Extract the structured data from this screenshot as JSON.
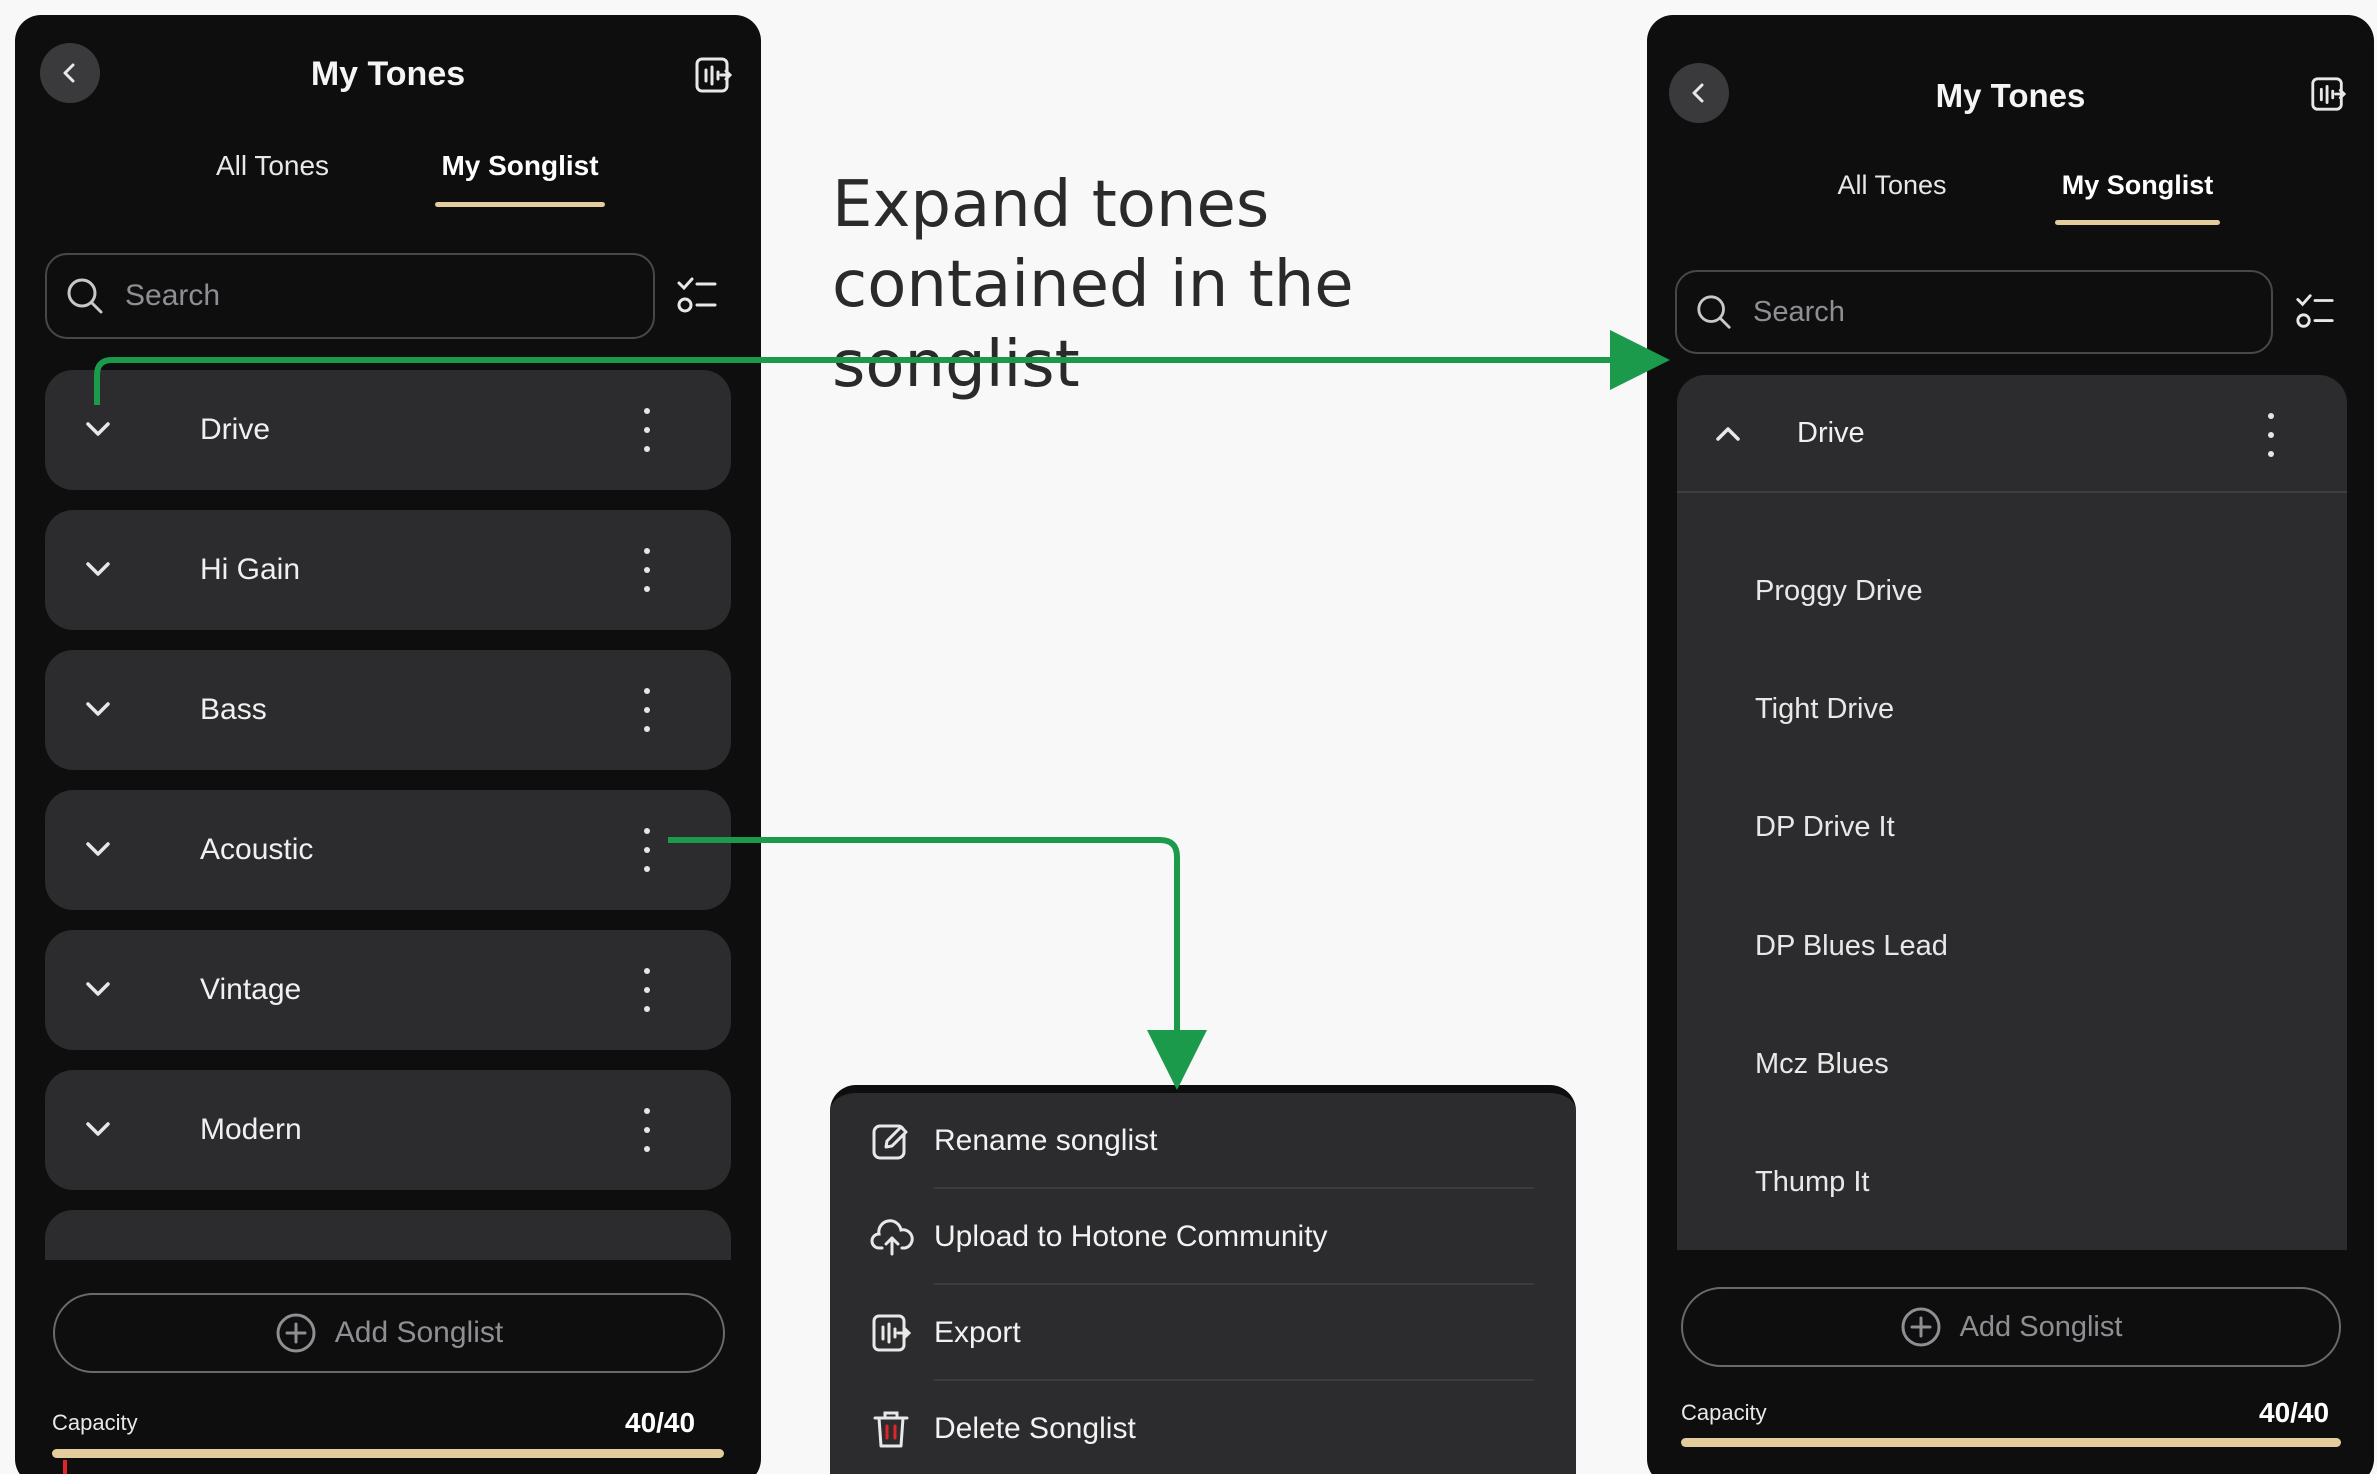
{
  "caption": "Expand tones contained in the songlist",
  "left_screen": {
    "title": "My Tones",
    "tabs": [
      "All Tones",
      "My Songlist"
    ],
    "active_tab": "My Songlist",
    "search": {
      "placeholder": "Search"
    },
    "songlists": [
      "Drive",
      "Hi Gain",
      "Bass",
      "Acoustic",
      "Vintage",
      "Modern"
    ],
    "add_songlist_label": "Add Songlist",
    "capacity": {
      "label": "Capacity",
      "value": "40/40",
      "fraction": 1.0
    }
  },
  "context_menu": {
    "items": [
      {
        "label": "Rename songlist",
        "icon": "edit-icon"
      },
      {
        "label": "Upload to Hotone Community",
        "icon": "cloud-upload-icon"
      },
      {
        "label": "Export",
        "icon": "export-icon"
      },
      {
        "label": "Delete Songlist",
        "icon": "trash-icon"
      }
    ]
  },
  "right_screen": {
    "title": "My Tones",
    "tabs": [
      "All Tones",
      "My Songlist"
    ],
    "active_tab": "My Songlist",
    "search": {
      "placeholder": "Search"
    },
    "expanded_songlist": "Drive",
    "tones": [
      "Proggy Drive",
      "Tight Drive",
      "DP Drive It",
      "DP Blues Lead",
      "Mcz Blues",
      "Thump It"
    ],
    "add_songlist_label": "Add Songlist",
    "capacity": {
      "label": "Capacity",
      "value": "40/40",
      "fraction": 1.0
    }
  },
  "colors": {
    "phone_bg": "#0e0e0f",
    "row_bg": "#2c2c2e",
    "accent_gold": "#e3cd9d",
    "arrow_green": "#1a9a4a",
    "page_bg": "#f8f8f8"
  }
}
